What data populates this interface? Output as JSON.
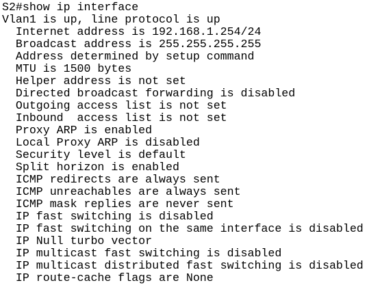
{
  "terminal": {
    "lines": [
      "S2#show ip interface",
      "Vlan1 is up, line protocol is up",
      "  Internet address is 192.168.1.254/24",
      "  Broadcast address is 255.255.255.255",
      "  Address determined by setup command",
      "  MTU is 1500 bytes",
      "  Helper address is not set",
      "  Directed broadcast forwarding is disabled",
      "  Outgoing access list is not set",
      "  Inbound  access list is not set",
      "  Proxy ARP is enabled",
      "  Local Proxy ARP is disabled",
      "  Security level is default",
      "  Split horizon is enabled",
      "  ICMP redirects are always sent",
      "  ICMP unreachables are always sent",
      "  ICMP mask replies are never sent",
      "  IP fast switching is disabled",
      "  IP fast switching on the same interface is disabled",
      "  IP Null turbo vector",
      "  IP multicast fast switching is disabled",
      "  IP multicast distributed fast switching is disabled",
      "  IP route-cache flags are None"
    ]
  }
}
